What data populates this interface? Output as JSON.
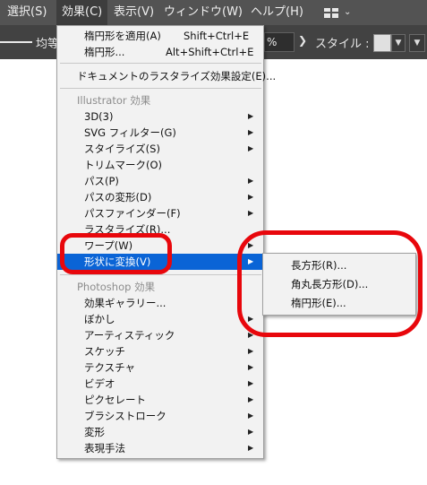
{
  "menubar": {
    "items": [
      {
        "label": "選択(S)"
      },
      {
        "label": "効果(C)"
      },
      {
        "label": "表示(V)"
      },
      {
        "label": "ウィンドウ(W)"
      },
      {
        "label": "ヘルプ(H)"
      }
    ],
    "workspace_icon": "workspace-grid-icon"
  },
  "controlbar": {
    "stroke_profile_label": "均等",
    "opacity_value": "%",
    "style_label": "スタイル :"
  },
  "effect_menu": {
    "apply_last": {
      "label": "楕円形を適用(A)",
      "shortcut": "Shift+Ctrl+E"
    },
    "last_effect": {
      "label": "楕円形...",
      "shortcut": "Alt+Shift+Ctrl+E"
    },
    "raster_settings": {
      "label": "ドキュメントのラスタライズ効果設定(E)..."
    },
    "illustrator_header": "Illustrator 効果",
    "illustrator_items": [
      {
        "label": "3D(3)"
      },
      {
        "label": "SVG フィルター(G)"
      },
      {
        "label": "スタイライズ(S)"
      },
      {
        "label": "トリムマーク(O)"
      },
      {
        "label": "パス(P)"
      },
      {
        "label": "パスの変形(D)"
      },
      {
        "label": "パスファインダー(F)"
      },
      {
        "label": "ラスタライズ(R)..."
      },
      {
        "label": "ワープ(W)"
      },
      {
        "label": "形状に変換(V)"
      }
    ],
    "photoshop_header": "Photoshop 効果",
    "photoshop_items": [
      {
        "label": "効果ギャラリー..."
      },
      {
        "label": "ぼかし"
      },
      {
        "label": "アーティスティック"
      },
      {
        "label": "スケッチ"
      },
      {
        "label": "テクスチャ"
      },
      {
        "label": "ビデオ"
      },
      {
        "label": "ピクセレート"
      },
      {
        "label": "ブラシストローク"
      },
      {
        "label": "変形"
      },
      {
        "label": "表現手法"
      }
    ]
  },
  "convert_shape_submenu": {
    "items": [
      {
        "label": "長方形(R)..."
      },
      {
        "label": "角丸長方形(D)..."
      },
      {
        "label": "楕円形(E)..."
      }
    ]
  },
  "colors": {
    "highlight": "#0a64d6",
    "annotation": "#e8070c",
    "menubar_bg": "#535353"
  }
}
